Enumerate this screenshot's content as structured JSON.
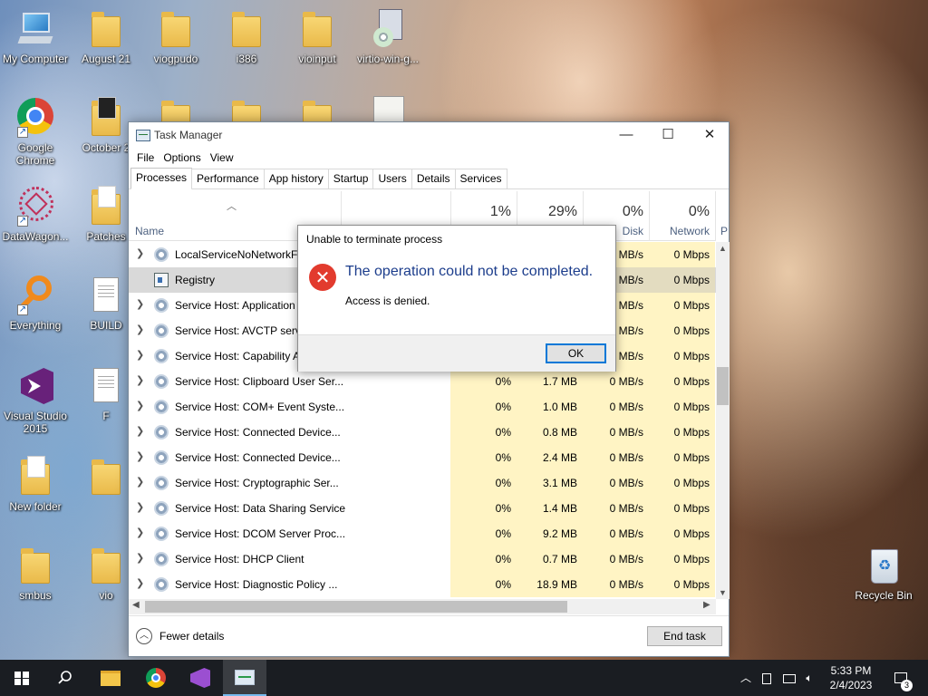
{
  "desktop": {
    "icons": [
      {
        "label": "My Computer",
        "icon": "computer-icon"
      },
      {
        "label": "August 21",
        "icon": "folder-icon"
      },
      {
        "label": "viogpudo",
        "icon": "folder-icon"
      },
      {
        "label": "i386",
        "icon": "folder-icon"
      },
      {
        "label": "vioinput",
        "icon": "folder-icon"
      },
      {
        "label": "virtio-win-g...",
        "icon": "installer-icon"
      },
      {
        "label": "Google Chrome",
        "icon": "chrome-icon"
      },
      {
        "label": "October 2",
        "icon": "folder-icon"
      },
      {
        "label": "DataWagon...",
        "icon": "datawagon-icon"
      },
      {
        "label": "Patches",
        "icon": "folder-icon"
      },
      {
        "label": "Everything",
        "icon": "everything-icon"
      },
      {
        "label": "BUILD",
        "icon": "document-icon"
      },
      {
        "label": "Visual Studio 2015",
        "icon": "visual-studio-icon"
      },
      {
        "label": "F",
        "icon": "document-icon"
      },
      {
        "label": "New folder",
        "icon": "folder-icon"
      },
      {
        "label": "smbus",
        "icon": "folder-icon"
      },
      {
        "label": "vio",
        "icon": "folder-icon"
      },
      {
        "label": "Recycle Bin",
        "icon": "recycle-bin-icon"
      }
    ]
  },
  "taskmgr": {
    "title": "Task Manager",
    "window_buttons": {
      "minimize": "—",
      "maximize": "☐",
      "close": "✕"
    },
    "menu": [
      "File",
      "Options",
      "View"
    ],
    "tabs": [
      "Processes",
      "Performance",
      "App history",
      "Startup",
      "Users",
      "Details",
      "Services"
    ],
    "active_tab": "Processes",
    "columns": {
      "name": "Name",
      "cpu": {
        "pct": "1%",
        "label": ""
      },
      "memory": {
        "pct": "29%",
        "label": ""
      },
      "disk": {
        "pct": "0%",
        "label": "Disk"
      },
      "network": {
        "pct": "0%",
        "label": "Network"
      },
      "extra": "P"
    },
    "rows": [
      {
        "name": "LocalServiceNoNetworkFi",
        "cpu": "",
        "mem": "",
        "disk": "MB/s",
        "net": "0 Mbps",
        "expand": true,
        "icon": "gear-icon"
      },
      {
        "name": "Registry",
        "cpu": "",
        "mem": "",
        "disk": "MB/s",
        "net": "0 Mbps",
        "expand": false,
        "icon": "registry-icon",
        "selected": true
      },
      {
        "name": "Service Host: Application I",
        "cpu": "",
        "mem": "",
        "disk": "MB/s",
        "net": "0 Mbps",
        "expand": true,
        "icon": "gear-icon"
      },
      {
        "name": "Service Host: AVCTP servic",
        "cpu": "",
        "mem": "",
        "disk": "MB/s",
        "net": "0 Mbps",
        "expand": true,
        "icon": "gear-icon"
      },
      {
        "name": "Service Host: Capability A",
        "cpu": "",
        "mem": "",
        "disk": "MB/s",
        "net": "0 Mbps",
        "expand": true,
        "icon": "gear-icon"
      },
      {
        "name": "Service Host: Clipboard User Ser...",
        "cpu": "0%",
        "mem": "1.7 MB",
        "disk": "0 MB/s",
        "net": "0 Mbps",
        "expand": true,
        "icon": "gear-icon"
      },
      {
        "name": "Service Host: COM+ Event Syste...",
        "cpu": "0%",
        "mem": "1.0 MB",
        "disk": "0 MB/s",
        "net": "0 Mbps",
        "expand": true,
        "icon": "gear-icon"
      },
      {
        "name": "Service Host: Connected Device...",
        "cpu": "0%",
        "mem": "0.8 MB",
        "disk": "0 MB/s",
        "net": "0 Mbps",
        "expand": true,
        "icon": "gear-icon"
      },
      {
        "name": "Service Host: Connected Device...",
        "cpu": "0%",
        "mem": "2.4 MB",
        "disk": "0 MB/s",
        "net": "0 Mbps",
        "expand": true,
        "icon": "gear-icon"
      },
      {
        "name": "Service Host: Cryptographic Ser...",
        "cpu": "0%",
        "mem": "3.1 MB",
        "disk": "0 MB/s",
        "net": "0 Mbps",
        "expand": true,
        "icon": "gear-icon"
      },
      {
        "name": "Service Host: Data Sharing Service",
        "cpu": "0%",
        "mem": "1.4 MB",
        "disk": "0 MB/s",
        "net": "0 Mbps",
        "expand": true,
        "icon": "gear-icon"
      },
      {
        "name": "Service Host: DCOM Server Proc...",
        "cpu": "0%",
        "mem": "9.2 MB",
        "disk": "0 MB/s",
        "net": "0 Mbps",
        "expand": true,
        "icon": "gear-icon"
      },
      {
        "name": "Service Host: DHCP Client",
        "cpu": "0%",
        "mem": "0.7 MB",
        "disk": "0 MB/s",
        "net": "0 Mbps",
        "expand": true,
        "icon": "gear-icon"
      },
      {
        "name": "Service Host: Diagnostic Policy ...",
        "cpu": "0%",
        "mem": "18.9 MB",
        "disk": "0 MB/s",
        "net": "0 Mbps",
        "expand": true,
        "icon": "gear-icon"
      }
    ],
    "footer": {
      "fewer_details": "Fewer details",
      "end_task": "End task"
    }
  },
  "dialog": {
    "title": "Unable to terminate process",
    "message": "The operation could not be completed.",
    "detail": "Access is denied.",
    "ok": "OK",
    "icon": "error-icon"
  },
  "taskbar": {
    "items": [
      "start-icon",
      "search-icon",
      "file-explorer-icon",
      "chrome-icon",
      "visual-studio-icon",
      "task-manager-icon"
    ],
    "active": "task-manager-icon",
    "time": "5:33 PM",
    "date": "2/4/2023",
    "notifications": "3"
  },
  "colors": {
    "accent": "#0078d7",
    "taskbar": "#1a1d22",
    "heat": "#fff4c4",
    "error": "#e23b2e",
    "dialog_heading": "#1c3d8c"
  }
}
